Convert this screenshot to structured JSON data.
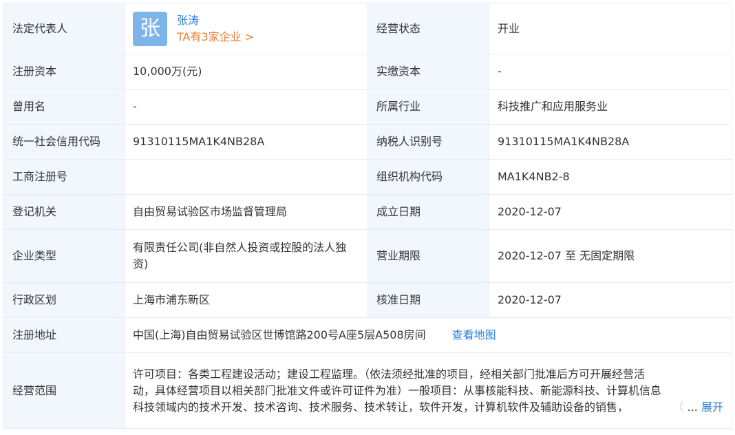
{
  "rows": {
    "legal_rep": {
      "label": "法定代表人",
      "avatar_char": "张",
      "name": "张涛",
      "companies_link": "TA有3家企业 >"
    },
    "status": {
      "label": "经营状态",
      "value": "开业"
    },
    "reg_capital": {
      "label": "注册资本",
      "value": "10,000万(元)"
    },
    "paid_capital": {
      "label": "实缴资本",
      "value": "-"
    },
    "former_name": {
      "label": "曾用名",
      "value": "-"
    },
    "industry": {
      "label": "所属行业",
      "value": "科技推广和应用服务业"
    },
    "credit_code": {
      "label": "统一社会信用代码",
      "value": "91310115MA1K4NB28A"
    },
    "taxpayer_id": {
      "label": "纳税人识别号",
      "value": "91310115MA1K4NB28A"
    },
    "business_reg_no": {
      "label": "工商注册号",
      "value": ""
    },
    "org_code": {
      "label": "组织机构代码",
      "value": "MA1K4NB2-8"
    },
    "reg_authority": {
      "label": "登记机关",
      "value": "自由贸易试验区市场监督管理局"
    },
    "found_date": {
      "label": "成立日期",
      "value": "2020-12-07"
    },
    "company_type": {
      "label": "企业类型",
      "value": "有限责任公司(非自然人投资或控股的法人独资)"
    },
    "business_term": {
      "label": "营业期限",
      "value": "2020-12-07 至 无固定期限"
    },
    "admin_region": {
      "label": "行政区划",
      "value": "上海市浦东新区"
    },
    "approval_date": {
      "label": "核准日期",
      "value": "2020-12-07"
    },
    "address": {
      "label": "注册地址",
      "value": "中国(上海)自由贸易试验区世博馆路200号A座5层A508房间",
      "map_link": "查看地图"
    },
    "scope": {
      "label": "经营范围",
      "line1": "许可项目：各类工程建设活动；建设工程监理。（依法须经批准的项目，经相关部门批准后方可开展经营活",
      "line2": "动，具体经营项目以相关部门批准文件或许可证件为准）一般项目：从事核能科技、新能源科技、计算机信息",
      "line3": "科技领域内的技术开发、技术咨询、技术服务、技术转让，软件开发，计算机软件及辅助设备的销售，",
      "faint_char": "（",
      "ellipsis": "...",
      "expand": "展开"
    }
  },
  "colors": {
    "label_bg": "#f2f7fe",
    "border": "#e4ecf7",
    "link_blue": "#2f80d8",
    "link_orange": "#f07e2e",
    "avatar_bg": "#7db4ea"
  }
}
